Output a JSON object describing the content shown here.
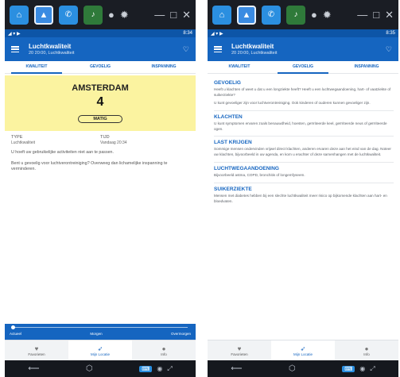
{
  "emulator": {
    "buttons": [
      "home-icon",
      "app-store-icon",
      "phone-app-icon",
      "phone-app-icon-2",
      "record-icon",
      "settings-icon"
    ],
    "window_controls": [
      "minimize-icon",
      "maximize-icon",
      "close-icon"
    ]
  },
  "left": {
    "status": {
      "time": "8:34"
    },
    "appbar": {
      "title": "Luchtkwaliteit",
      "subtitle": "20 20:00, Luchtkwaliteit"
    },
    "tabs": [
      "KWALITEIT",
      "GEVOELIG",
      "INSPANNING"
    ],
    "active_tab": 0,
    "quality": {
      "city": "AMSTERDAM",
      "index": "4",
      "level": "MATIG",
      "color": "#fbf3a0"
    },
    "meta": {
      "type_label": "TYPE",
      "type_value": "Luchtkwaliteit",
      "time_label": "TIJD",
      "time_value": "Vandaag 20:34"
    },
    "advice": [
      "U hoeft uw gebruikelijke activiteiten niet aan te passen.",
      "Bent u gevoelig voor luchtverontreiniging? Overweeg dan lichamelijke inspanning te verminderen."
    ],
    "slider": {
      "labels": [
        "Actueel",
        "Morgen",
        "Overmorgen"
      ]
    },
    "bottomnav": [
      {
        "label": "Favorieten",
        "icon": "heart-icon"
      },
      {
        "label": "Mijn Locatie",
        "icon": "location-icon"
      },
      {
        "label": "Info",
        "icon": "info-icon"
      }
    ]
  },
  "right": {
    "status": {
      "time": "8:35"
    },
    "appbar": {
      "title": "Luchtkwaliteit",
      "subtitle": "20 20:00, Luchtkwaliteit"
    },
    "tabs": [
      "KWALITEIT",
      "GEVOELIG",
      "INSPANNING"
    ],
    "active_tab": 1,
    "sections": [
      {
        "title": "GEVOELIG",
        "texts": [
          "Heeft u klachten of weet u dat u een longziekte heeft? Heeft u een luchtwegaandoening, hart- of vaatziekte of suikerziekte?",
          "U kunt gevoeliger zijn voor luchtverontreiniging. Ook kinderen of ouderen kunnen gevoeliger zijn."
        ]
      },
      {
        "title": "KLACHTEN",
        "texts": [
          "U kunt symptomen ervaren zoals benauwdheid, hoesten, geïrriteerde keel, geïrriteerde neus of geïrriteerde ogen."
        ]
      },
      {
        "title": "LAST KRIJGEN",
        "texts": [
          "Sommige mensen ondervinden vrijwel direct klachten, anderen ervaren deze aan het eind van de dag. Noteer uw klachten, bijvoorbeeld in uw agenda, en kom u erachter of deze samenhangen met de luchtkwaliteit."
        ]
      },
      {
        "title": "LUCHTWEGAANDOENING",
        "texts": [
          "Bijvoorbeeld astma, COPD, bronchitis of longemfyseem."
        ]
      },
      {
        "title": "SUIKERZIEKTE",
        "texts": [
          "Mensen met diabetes hebben bij een slechte luchtkwaliteit meer risico op bijkomende klachten aan hart- en bloedvaten."
        ]
      }
    ],
    "bottomnav": [
      {
        "label": "Favorieten",
        "icon": "heart-icon"
      },
      {
        "label": "Mijn Locatie",
        "icon": "location-icon"
      },
      {
        "label": "Info",
        "icon": "info-icon"
      }
    ]
  }
}
